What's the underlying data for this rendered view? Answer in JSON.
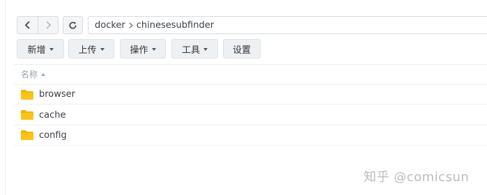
{
  "toolbar": {
    "path": [
      "docker",
      "chinesesubfinder"
    ],
    "actions": [
      "新增",
      "上传",
      "操作",
      "工具",
      "设置"
    ]
  },
  "list": {
    "column_name": "名称",
    "items": [
      "browser",
      "cache",
      "config"
    ]
  },
  "watermark": "知乎 @comicsun",
  "colors": {
    "folder": "#f5b400",
    "border": "#d5dbe1"
  }
}
